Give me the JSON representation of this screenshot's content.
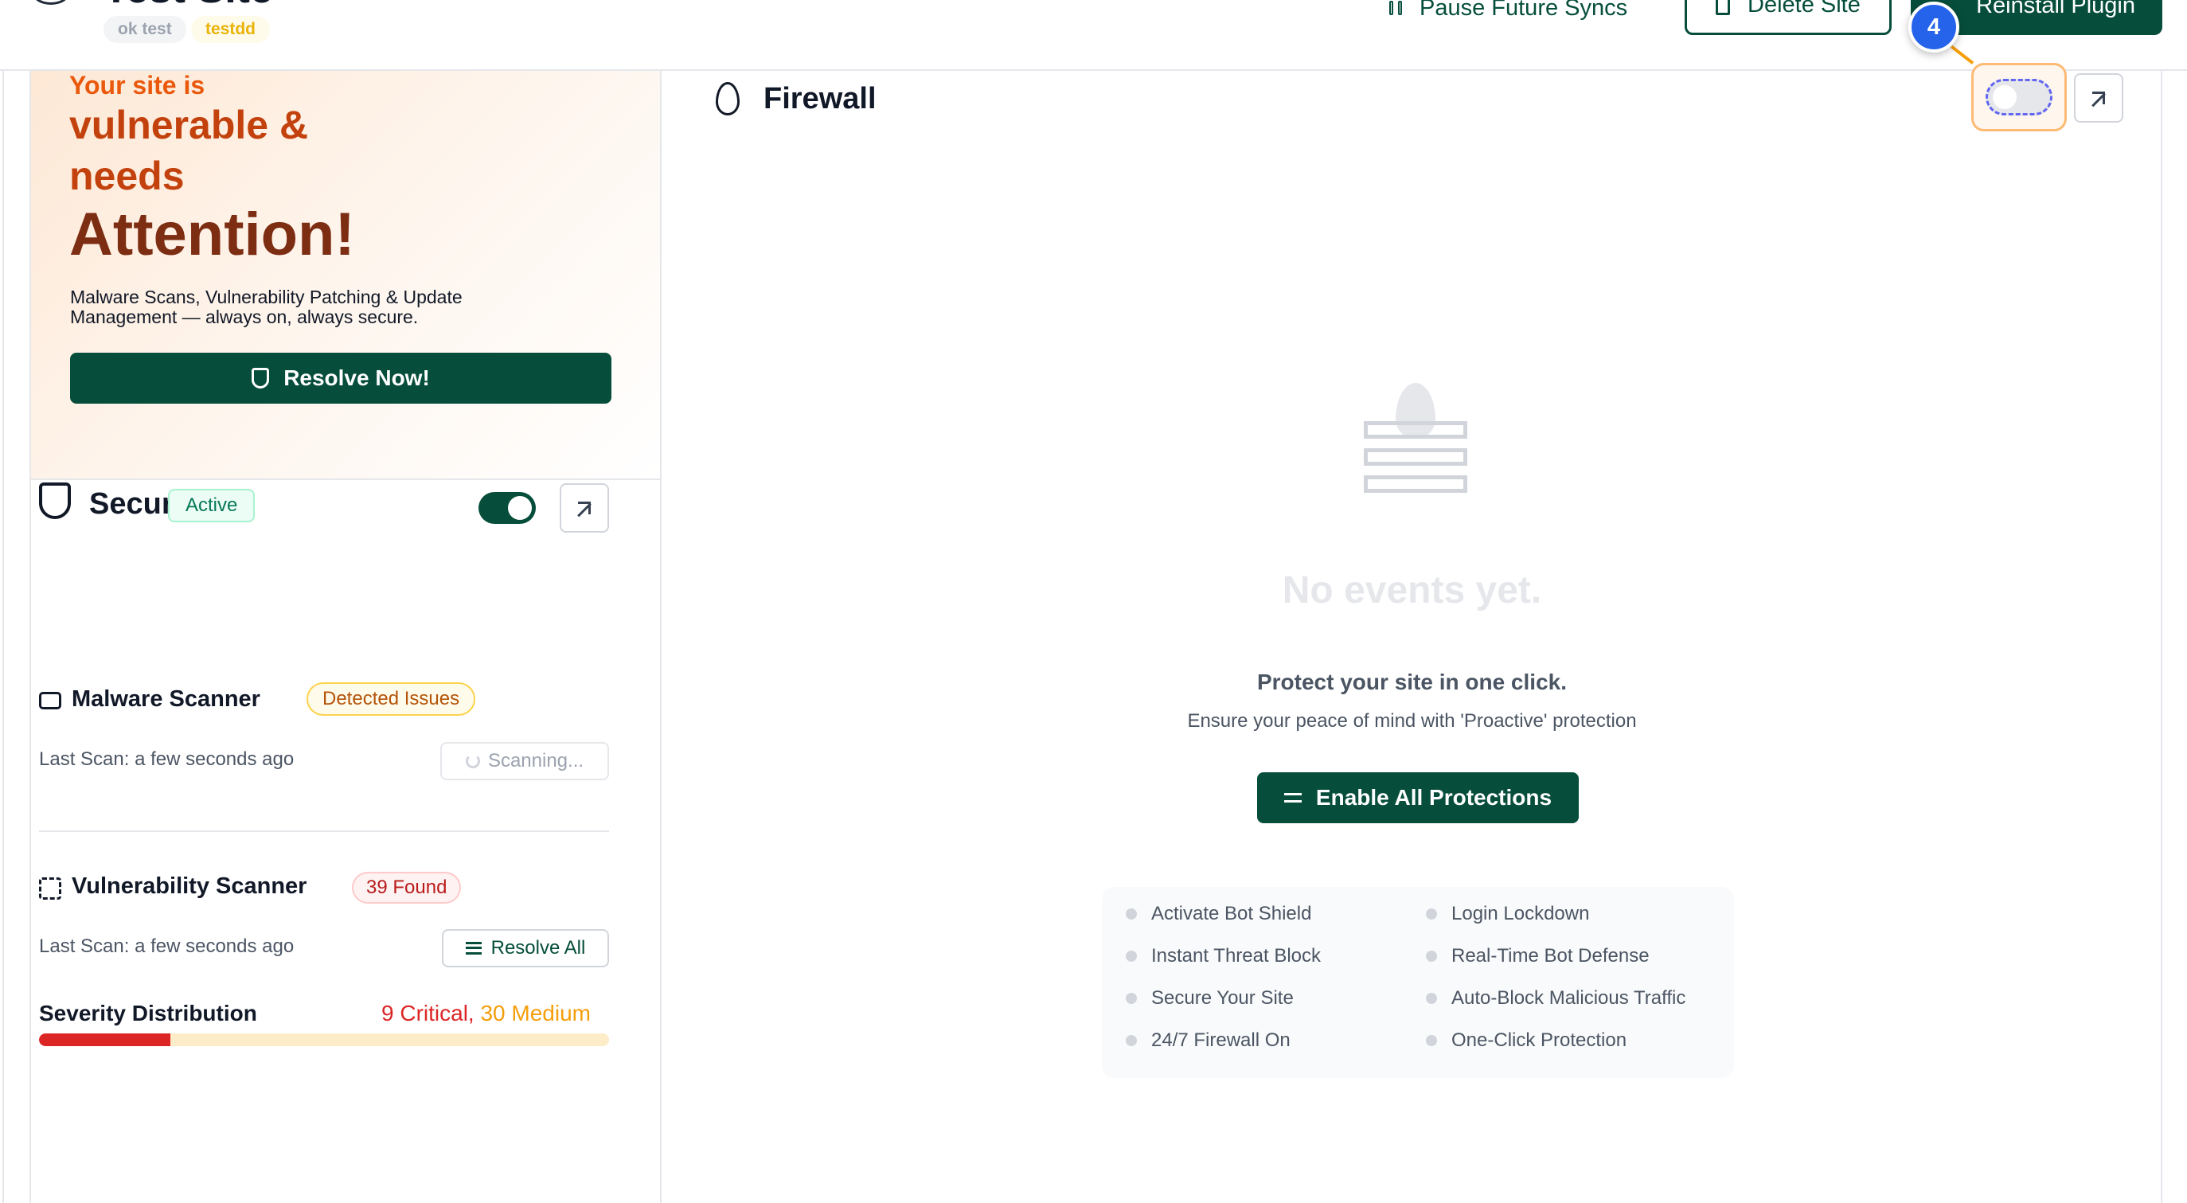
{
  "header": {
    "site_title": "Test Site",
    "tags": [
      "ok test",
      "testdd"
    ],
    "pause_label": "Pause Future Syncs",
    "delete_label": "Delete Site",
    "reinstall_label": "Reinstall Plugin",
    "step_number": "4"
  },
  "hero": {
    "line1": "Your site is",
    "line2": "vulnerable &",
    "line3": "needs",
    "line4": "Attention!",
    "description": "Malware Scans, Vulnerability Patching & Update Management — always on, always secure.",
    "cta_label": "Resolve Now!"
  },
  "security": {
    "title": "Security",
    "status_badge": "Active",
    "toggle_on": true,
    "malware": {
      "title": "Malware Scanner",
      "badge": "Detected Issues",
      "last_scan": "Last Scan: a few seconds ago",
      "action_label": "Scanning..."
    },
    "vulnerability": {
      "title": "Vulnerability Scanner",
      "badge": "39 Found",
      "last_scan": "Last Scan: a few seconds ago",
      "action_label": "Resolve All"
    },
    "severity": {
      "label": "Severity Distribution",
      "critical_text": "9 Critical",
      "separator": ",",
      "medium_text": "30 Medium",
      "critical_count": 9,
      "medium_count": 30
    }
  },
  "firewall": {
    "title": "Firewall",
    "toggle_on": false,
    "empty_title": "No events yet.",
    "protect_title": "Protect your site in one click.",
    "protect_subtitle": "Ensure your peace of mind with 'Proactive' protection",
    "enable_label": "Enable All Protections",
    "features_left": [
      "Activate Bot Shield",
      "Instant Threat Block",
      "Secure Your Site",
      "24/7 Firewall On"
    ],
    "features_right": [
      "Login Lockdown",
      "Real-Time Bot Defense",
      "Auto-Block Malicious Traffic",
      "One-Click Protection"
    ]
  },
  "colors": {
    "brand_green": "#064e3b",
    "alert_orange": "#ea580c",
    "critical_red": "#dc2626",
    "medium_amber": "#f59e0b",
    "step_blue": "#2563eb"
  }
}
